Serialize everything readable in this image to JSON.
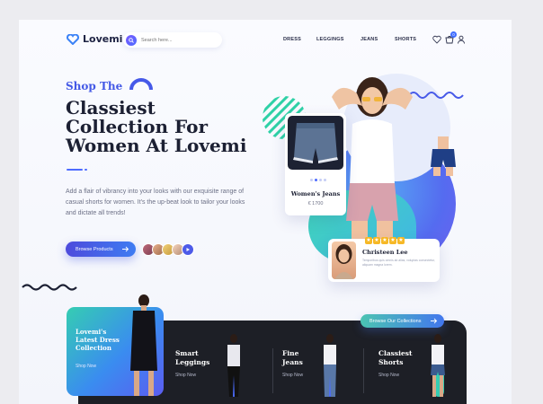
{
  "brand": {
    "name": "Lovemi"
  },
  "search": {
    "placeholder": "Search here..."
  },
  "nav": {
    "items": [
      "DRESS",
      "LEGGINGS",
      "JEANS",
      "SHORTS"
    ]
  },
  "cart": {
    "count": "0"
  },
  "hero": {
    "eyebrow": "Shop The",
    "headline_lines": [
      "Classiest",
      "Collection For",
      "Women At Lovemi"
    ],
    "description": "Add a flair of vibrancy into your looks with our exquisite range of casual shorts for women. It's the up-beat look to tailor your looks and dictate all trends!",
    "cta_label": "Browse Products"
  },
  "product_card": {
    "name": "Women's Jeans",
    "price": "€ 1700"
  },
  "review": {
    "name": "Christeen Lee",
    "text": "Temporibus quis omnis ab alias, voluptas consectetur, aliquam magna lorem."
  },
  "collections": {
    "cta_label": "Browse Our Collections",
    "featured": {
      "title": "Lovemi's Latest Dress Collection",
      "link": "Shop Now"
    },
    "categories": [
      {
        "title": "Smart Leggings",
        "link": "Shop Now"
      },
      {
        "title": "Fine Jeans",
        "link": "Shop Now"
      },
      {
        "title": "Classiest Shorts",
        "link": "Shop Now"
      }
    ]
  },
  "colors": {
    "accent": "#4d6bff",
    "teal": "#35cdb2",
    "dark": "#1d1f26",
    "star": "#f6b826"
  }
}
